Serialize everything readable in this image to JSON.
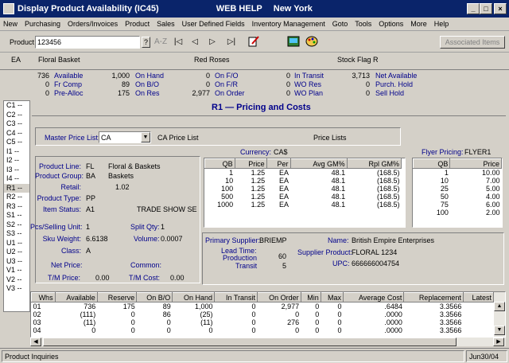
{
  "window": {
    "title": "Display Product Availability (IC45)",
    "help": "WEB HELP",
    "location": "New York",
    "min": "_",
    "max": "□",
    "close": "×"
  },
  "menu": [
    "New",
    "Purchasing",
    "Orders/Invoices",
    "Product",
    "Sales",
    "User Defined Fields",
    "Inventory Management",
    "Goto",
    "Tools",
    "Options",
    "More",
    "Help"
  ],
  "toolbar": {
    "product_label": "Product",
    "product_value": "123456",
    "help": "?",
    "sort": "A-Z",
    "first": "|◁",
    "prev": "◁",
    "next": "▷",
    "last": "▷|",
    "assoc": "Associated Items"
  },
  "info": {
    "unit": "EA",
    "desc": "Floral Basket",
    "desc2": "Red Roses",
    "stock_flag": "Stock Flag R"
  },
  "avail": [
    [
      "736",
      "Available",
      "1,000",
      "On Hand",
      "0",
      "On F/O",
      "0",
      "In Transit",
      "3,713",
      "Net Available"
    ],
    [
      "0",
      "Fr Comp",
      "89",
      "On B/O",
      "0",
      "On F/R",
      "0",
      "WO Res",
      "0",
      "Purch. Hold"
    ],
    [
      "0",
      "Pre-Alloc",
      "175",
      "On Res",
      "2,977",
      "On Order",
      "0",
      "WO Plan",
      "0",
      "Sell Hold"
    ]
  ],
  "sidebar": [
    "C1 --",
    "C2 --",
    "C3 --",
    "C4 --",
    "C5 --",
    "I1 --",
    "I2 --",
    "I3 --",
    "I4 --",
    "R1 --",
    "R2 --",
    "R3 --",
    "S1 --",
    "S2 --",
    "S3 --",
    "U1 --",
    "U2 --",
    "U3 --",
    "V1 --",
    "V2 --",
    "V3 --"
  ],
  "section": {
    "title": "R1 — Pricing and Costs"
  },
  "price": {
    "master_label": "Master Price List:",
    "master_value": "CA",
    "master_desc": "CA Price List",
    "price_lists": "Price Lists",
    "currency_label": "Currency:",
    "currency": "CA$",
    "flyer_label": "Flyer Pricing:",
    "flyer": "FLYER1"
  },
  "product": {
    "line_label": "Product Line:",
    "line_code": "FL",
    "line_desc": "Floral & Baskets",
    "group_label": "Product Group:",
    "group_code": "BA",
    "group_desc": "Baskets",
    "retail_label": "Retail:",
    "retail": "1.02",
    "type_label": "Product Type:",
    "type": "PP",
    "status_label": "Item Status:",
    "status": "A1",
    "status_desc": "TRADE SHOW SE",
    "pcs_label": "Pcs/Selling Unit:",
    "pcs": "1",
    "split_label": "Split Qty:",
    "split": "1",
    "sku_label": "Sku Weight:",
    "sku": "6.6138",
    "vol_label": "Volume:",
    "vol": "0.0007",
    "class_label": "Class:",
    "class": "A",
    "net_label": "Net Price:",
    "common_label": "Common:",
    "tm_price_label": "T/M Price:",
    "tm_price": "0.00",
    "tm_cost_label": "T/M Cost:",
    "tm_cost": "0.00"
  },
  "price_table": {
    "headers": [
      "QB",
      "Price",
      "Per",
      "Avg GM%",
      "Rpl GM%"
    ],
    "rows": [
      [
        "1",
        "1.25",
        "EA",
        "48.1",
        "(168.5)"
      ],
      [
        "10",
        "1.25",
        "EA",
        "48.1",
        "(168.5)"
      ],
      [
        "100",
        "1.25",
        "EA",
        "48.1",
        "(168.5)"
      ],
      [
        "500",
        "1.25",
        "EA",
        "48.1",
        "(168.5)"
      ],
      [
        "1000",
        "1.25",
        "EA",
        "48.1",
        "(168.5)"
      ]
    ]
  },
  "flyer_table": {
    "headers": [
      "QB",
      "Price"
    ],
    "rows": [
      [
        "1",
        "10.00"
      ],
      [
        "10",
        "7.00"
      ],
      [
        "25",
        "5.00"
      ],
      [
        "50",
        "4.00"
      ],
      [
        "75",
        "6.00"
      ],
      [
        "100",
        "2.00"
      ]
    ]
  },
  "supplier": {
    "primary_label": "Primary Supplier:",
    "primary": "BRIEMP",
    "name_label": "Name:",
    "name": "British Empire Enterprises",
    "lead_label": "Lead Time:",
    "production_label": "Production",
    "production": "60",
    "transit_label": "Transit",
    "transit": "5",
    "sp_label": "Supplier Product:",
    "sp": "FLORAL 1234",
    "upc_label": "UPC:",
    "upc": "666666004754"
  },
  "whs_table": {
    "headers": [
      "Whs",
      "Available",
      "Reserve",
      "On B/O",
      "On Hand",
      "In Transit",
      "On Order",
      "Min",
      "Max",
      "Average Cost",
      "Replacement",
      "Latest"
    ],
    "rows": [
      [
        "01",
        "736",
        "175",
        "89",
        "1,000",
        "0",
        "2,977",
        "0",
        "0",
        ".6484",
        "3.3566",
        ""
      ],
      [
        "02",
        "(111)",
        "0",
        "86",
        "(25)",
        "0",
        "0",
        "0",
        "0",
        ".0000",
        "3.3566",
        ""
      ],
      [
        "03",
        "(11)",
        "0",
        "0",
        "(11)",
        "0",
        "276",
        "0",
        "0",
        ".0000",
        "3.3566",
        ""
      ],
      [
        "04",
        "0",
        "0",
        "0",
        "0",
        "0",
        "0",
        "0",
        "0",
        ".0000",
        "3.3566",
        ""
      ]
    ]
  },
  "status": {
    "text": "Product Inquiries",
    "date": "Jun30/04"
  },
  "colors": {
    "titlebar": "#0a246a",
    "accent_text": "#00008b",
    "face": "#d4d0c8"
  }
}
